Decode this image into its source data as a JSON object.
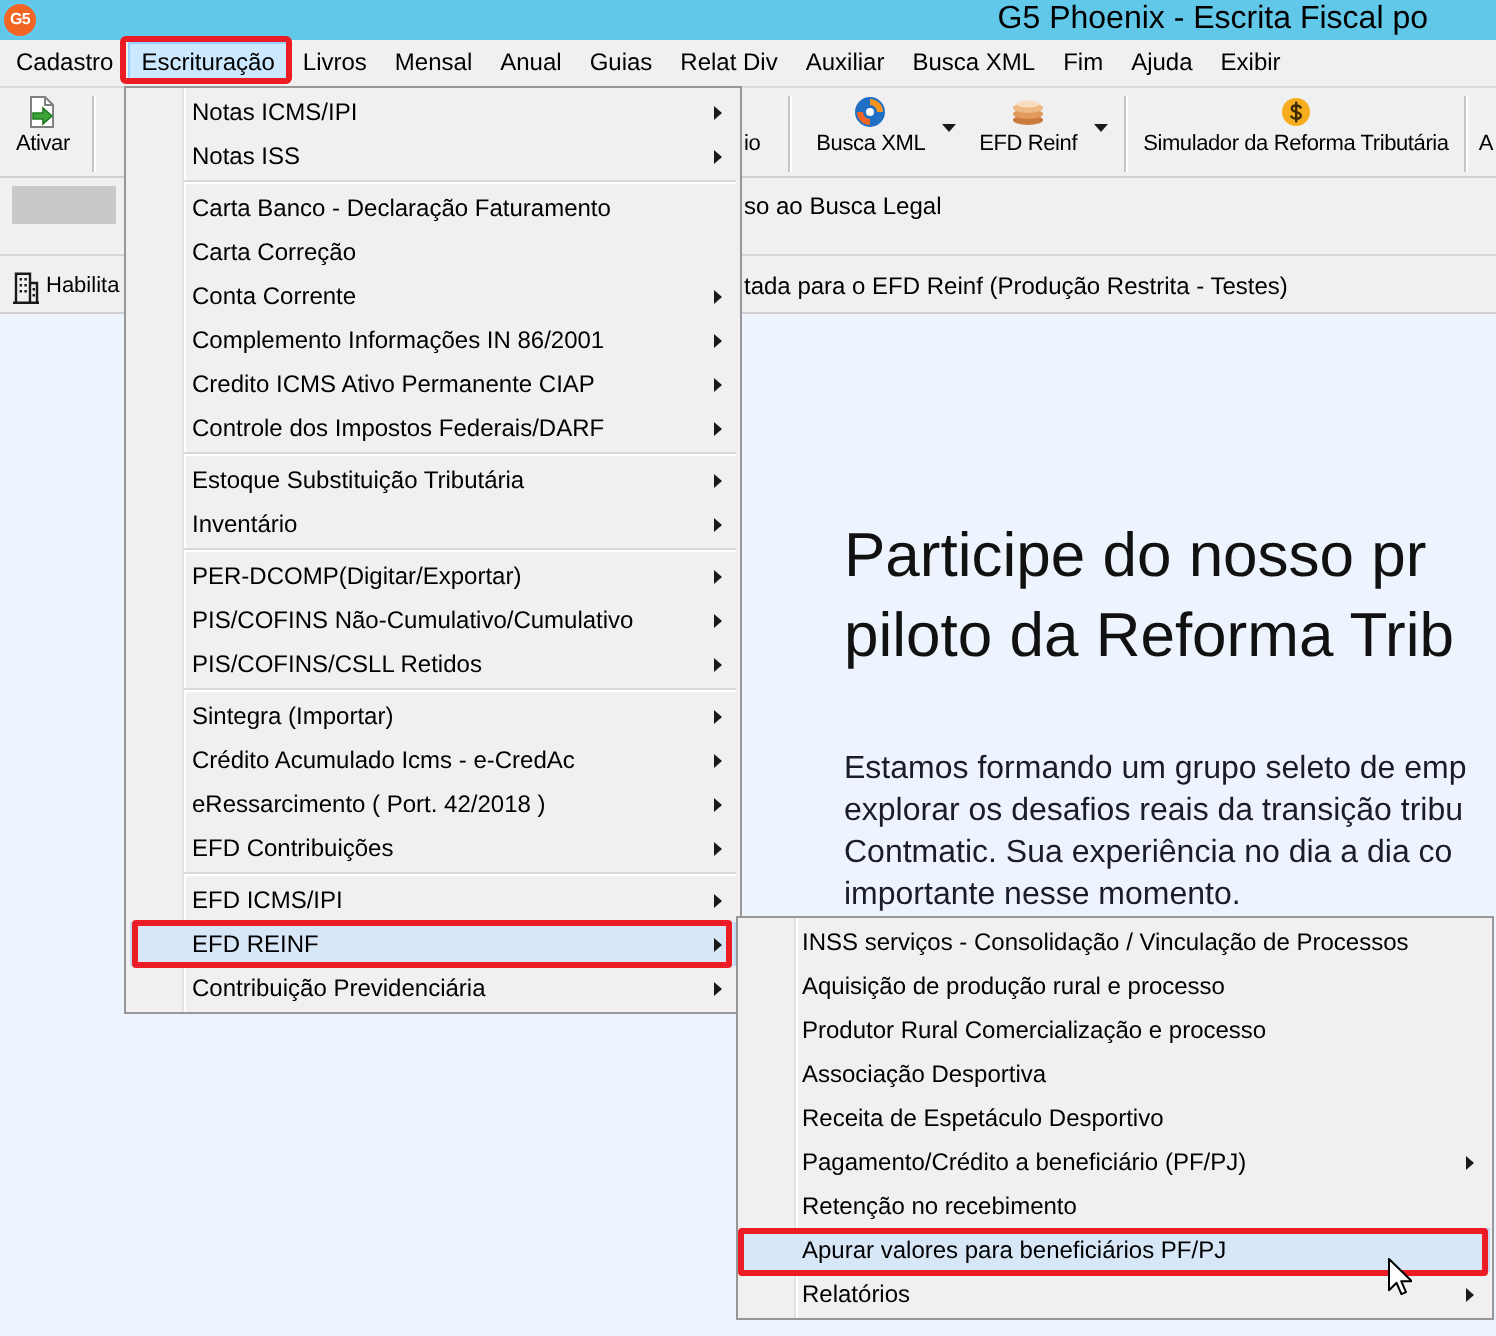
{
  "window": {
    "logo": "G5",
    "title": "G5 Phoenix - Escrita Fiscal po"
  },
  "menu_bar": [
    {
      "label": "Cadastro",
      "selected": false,
      "annotated": false
    },
    {
      "label": "Escrituração",
      "selected": true,
      "annotated": true
    },
    {
      "label": "Livros",
      "selected": false,
      "annotated": false
    },
    {
      "label": "Mensal",
      "selected": false,
      "annotated": false
    },
    {
      "label": "Anual",
      "selected": false,
      "annotated": false
    },
    {
      "label": "Guias",
      "selected": false,
      "annotated": false
    },
    {
      "label": "Relat Div",
      "selected": false,
      "annotated": false
    },
    {
      "label": "Auxiliar",
      "selected": false,
      "annotated": false
    },
    {
      "label": "Busca XML",
      "selected": false,
      "annotated": false
    },
    {
      "label": "Fim",
      "selected": false,
      "annotated": false
    },
    {
      "label": "Ajuda",
      "selected": false,
      "annotated": false
    },
    {
      "label": "Exibir",
      "selected": false,
      "annotated": false
    }
  ],
  "toolbar": {
    "left": [
      {
        "kind": "button",
        "label": "Ativar"
      },
      {
        "kind": "separator"
      }
    ],
    "right": [
      {
        "kind": "fragment",
        "label": "io"
      },
      {
        "kind": "separator"
      },
      {
        "kind": "split",
        "label": "Busca XML"
      },
      {
        "kind": "split",
        "label": "EFD Reinf"
      },
      {
        "kind": "separator"
      },
      {
        "kind": "button",
        "label": "Simulador da Reforma Tributária"
      },
      {
        "kind": "separator"
      },
      {
        "kind": "fragment",
        "label": "A"
      }
    ]
  },
  "info_bar": {
    "text": "so ao Busca Legal"
  },
  "status_strip": {
    "label": "Habilita",
    "text": "tada para o EFD Reinf (Produção Restrita - Testes)"
  },
  "content": {
    "heading_lines": [
      "Participe do nosso pr",
      "piloto da Reforma Trib"
    ],
    "paragraph_lines": [
      "Estamos formando um grupo seleto de emp",
      "explorar os desafios reais da transição tribu",
      "Contmatic. Sua experiência no dia a dia co",
      "importante nesse momento."
    ]
  },
  "escrituracao_menu": [
    {
      "kind": "item",
      "label": "Notas ICMS/IPI",
      "submenu": true,
      "selected": false,
      "annotated": false
    },
    {
      "kind": "item",
      "label": "Notas ISS",
      "submenu": true,
      "selected": false,
      "annotated": false
    },
    {
      "kind": "separator"
    },
    {
      "kind": "item",
      "label": "Carta Banco - Declaração Faturamento",
      "submenu": false,
      "selected": false,
      "annotated": false
    },
    {
      "kind": "item",
      "label": "Carta Correção",
      "submenu": false,
      "selected": false,
      "annotated": false
    },
    {
      "kind": "item",
      "label": "Conta Corrente",
      "submenu": true,
      "selected": false,
      "annotated": false
    },
    {
      "kind": "item",
      "label": "Complemento Informações IN 86/2001",
      "submenu": true,
      "selected": false,
      "annotated": false
    },
    {
      "kind": "item",
      "label": "Credito ICMS Ativo Permanente CIAP",
      "submenu": true,
      "selected": false,
      "annotated": false
    },
    {
      "kind": "item",
      "label": "Controle dos Impostos Federais/DARF",
      "submenu": true,
      "selected": false,
      "annotated": false
    },
    {
      "kind": "separator"
    },
    {
      "kind": "item",
      "label": "Estoque Substituição Tributária",
      "submenu": true,
      "selected": false,
      "annotated": false
    },
    {
      "kind": "item",
      "label": "Inventário",
      "submenu": true,
      "selected": false,
      "annotated": false
    },
    {
      "kind": "separator"
    },
    {
      "kind": "item",
      "label": "PER-DCOMP(Digitar/Exportar)",
      "submenu": true,
      "selected": false,
      "annotated": false
    },
    {
      "kind": "item",
      "label": "PIS/COFINS Não-Cumulativo/Cumulativo",
      "submenu": true,
      "selected": false,
      "annotated": false
    },
    {
      "kind": "item",
      "label": "PIS/COFINS/CSLL Retidos",
      "submenu": true,
      "selected": false,
      "annotated": false
    },
    {
      "kind": "separator"
    },
    {
      "kind": "item",
      "label": "Sintegra (Importar)",
      "submenu": true,
      "selected": false,
      "annotated": false
    },
    {
      "kind": "item",
      "label": "Crédito Acumulado Icms - e-CredAc",
      "submenu": true,
      "selected": false,
      "annotated": false
    },
    {
      "kind": "item",
      "label": "eRessarcimento ( Port. 42/2018 )",
      "submenu": true,
      "selected": false,
      "annotated": false
    },
    {
      "kind": "item",
      "label": "EFD Contribuições",
      "submenu": true,
      "selected": false,
      "annotated": false
    },
    {
      "kind": "separator"
    },
    {
      "kind": "item",
      "label": "EFD ICMS/IPI",
      "submenu": true,
      "selected": false,
      "annotated": false
    },
    {
      "kind": "item",
      "label": "EFD REINF",
      "submenu": true,
      "selected": true,
      "annotated": true
    },
    {
      "kind": "item",
      "label": "Contribuição Previdenciária",
      "submenu": true,
      "selected": false,
      "annotated": false
    }
  ],
  "efd_reinf_submenu": [
    {
      "kind": "item",
      "label": "INSS serviços - Consolidação / Vinculação de Processos",
      "submenu": false,
      "selected": false,
      "annotated": false
    },
    {
      "kind": "item",
      "label": "Aquisição de produção rural e processo",
      "submenu": false,
      "selected": false,
      "annotated": false
    },
    {
      "kind": "item",
      "label": "Produtor Rural Comercialização e processo",
      "submenu": false,
      "selected": false,
      "annotated": false
    },
    {
      "kind": "item",
      "label": "Associação Desportiva",
      "submenu": false,
      "selected": false,
      "annotated": false
    },
    {
      "kind": "item",
      "label": "Receita de Espetáculo Desportivo",
      "submenu": false,
      "selected": false,
      "annotated": false
    },
    {
      "kind": "item",
      "label": "Pagamento/Crédito a beneficiário (PF/PJ)",
      "submenu": true,
      "selected": false,
      "annotated": false
    },
    {
      "kind": "item",
      "label": "Retenção no recebimento",
      "submenu": false,
      "selected": false,
      "annotated": false
    },
    {
      "kind": "item",
      "label": "Apurar valores para beneficiários PF/PJ",
      "submenu": false,
      "selected": true,
      "annotated": true
    },
    {
      "kind": "item",
      "label": "Relatórios",
      "submenu": true,
      "selected": false,
      "annotated": false
    }
  ]
}
